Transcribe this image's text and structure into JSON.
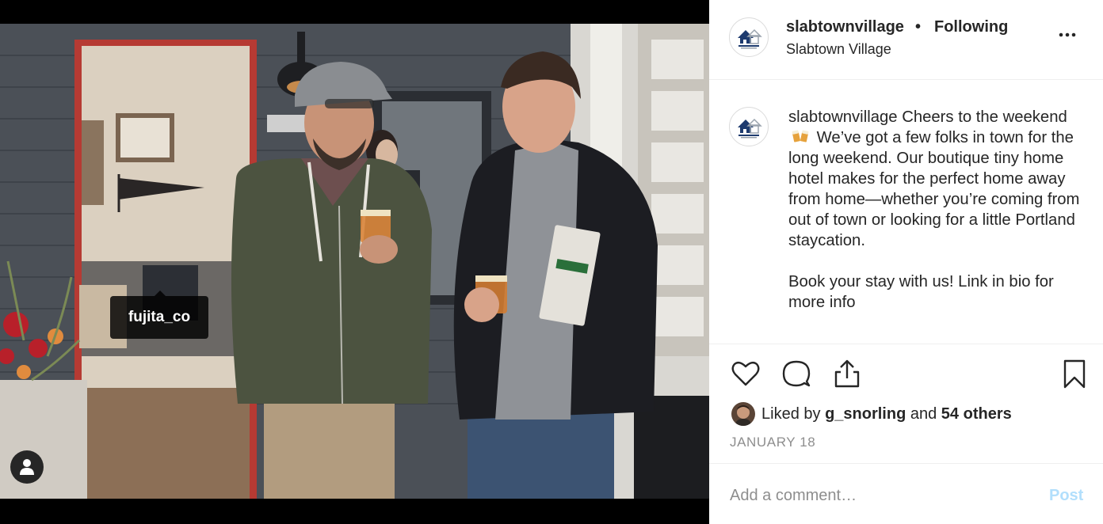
{
  "header": {
    "username": "slabtownvillage",
    "separator": "•",
    "follow_status": "Following",
    "location": "Slabtown Village",
    "more_icon": "more-horizontal-icon"
  },
  "photo": {
    "tag_username": "fujita_co",
    "user_tag_icon": "person-icon"
  },
  "caption": {
    "username": "slabtownvillage",
    "text_part1": "Cheers to the weekend",
    "emoji": "🍻",
    "text_part2": "We’ve got a few folks in town for the long weekend. Our boutique tiny home hotel makes for the perfect home away from home—whether you’re coming from out of town or looking for a little Portland staycation.",
    "text_part3": "Book your stay with us! Link in bio for more info"
  },
  "actions": {
    "like_icon": "heart-icon",
    "comment_icon": "comment-icon",
    "share_icon": "share-icon",
    "save_icon": "bookmark-icon"
  },
  "likes": {
    "prefix": "Liked by",
    "first_liker": "g_snorling",
    "and": "and",
    "others": "54 others"
  },
  "date": "JANUARY 18",
  "comment": {
    "placeholder": "Add a comment…",
    "post_label": "Post"
  },
  "colors": {
    "post_button_disabled": "#b2dffc",
    "muted_text": "#8e8e8e",
    "border": "#efefef",
    "logo_navy": "#1d3a6e"
  }
}
